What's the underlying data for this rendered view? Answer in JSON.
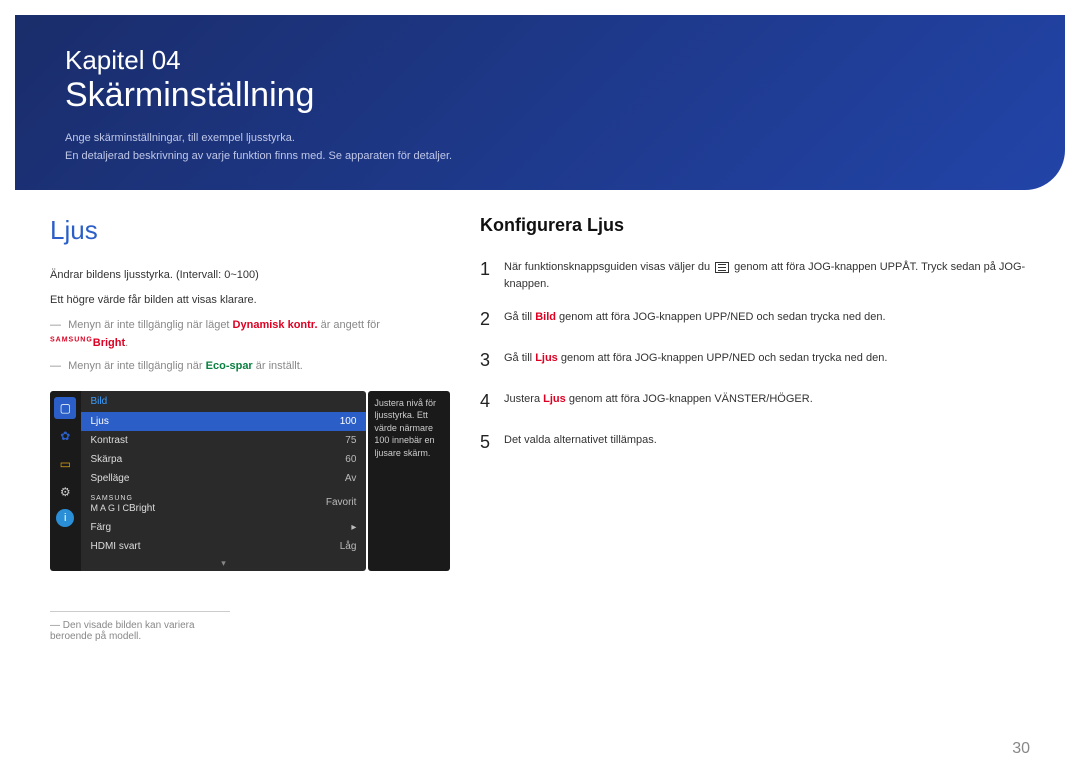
{
  "header": {
    "chapter": "Kapitel 04",
    "title": "Skärminställning",
    "subtitle1": "Ange skärminställningar, till exempel ljusstyrka.",
    "subtitle2": "En detaljerad beskrivning av varje funktion finns med. Se apparaten för detaljer."
  },
  "left": {
    "heading": "Ljus",
    "desc1": "Ändrar bildens ljusstyrka. (Intervall: 0~100)",
    "desc2": "Ett högre värde får bilden att visas klarare.",
    "note1_pre": "Menyn är inte tillgänglig när läget ",
    "note1_dyn": "Dynamisk kontr.",
    "note1_mid": " är angett för ",
    "note1_magic": "SAMSUNG",
    "note1_bright": "Bright",
    "note1_post": ".",
    "note2_pre": "Menyn är inte tillgänglig när ",
    "note2_eco": "Eco-spar",
    "note2_post": " är inställt.",
    "footnote": "Den visade bilden kan variera beroende på modell."
  },
  "osd": {
    "title": "Bild",
    "rows": [
      {
        "label": "Ljus",
        "value": "100",
        "sel": true
      },
      {
        "label": "Kontrast",
        "value": "75"
      },
      {
        "label": "Skärpa",
        "value": "60"
      },
      {
        "label": "Spelläge",
        "value": "Av"
      },
      {
        "label": "MAGICBright",
        "value": "Favorit",
        "magic": true
      },
      {
        "label": "Färg",
        "value": "▸"
      },
      {
        "label": "HDMI svart",
        "value": "Låg"
      }
    ],
    "tooltip": "Justera nivå för ljusstyrka. Ett värde närmare 100 innebär en ljusare skärm."
  },
  "right": {
    "heading": "Konfigurera Ljus",
    "steps": [
      {
        "n": "1",
        "pre": "När funktionsknappsguiden visas väljer du ",
        "post": " genom att föra JOG-knappen UPPÅT. Tryck sedan på JOG-knappen.",
        "icon": true
      },
      {
        "n": "2",
        "pre": "Gå till ",
        "bold": "Bild",
        "post": " genom att föra JOG-knappen UPP/NED och sedan trycka ned den."
      },
      {
        "n": "3",
        "pre": "Gå till ",
        "bold": "Ljus",
        "post": " genom att föra JOG-knappen UPP/NED och sedan trycka ned den."
      },
      {
        "n": "4",
        "pre": "Justera ",
        "bold": "Ljus",
        "post": " genom att föra JOG-knappen VÄNSTER/HÖGER."
      },
      {
        "n": "5",
        "pre": "Det valda alternativet tillämpas."
      }
    ]
  },
  "page": "30",
  "icons": {
    "monitor": "🖵",
    "flower": "✿",
    "rect": "▭",
    "gear": "⚙",
    "info": "ℹ"
  }
}
